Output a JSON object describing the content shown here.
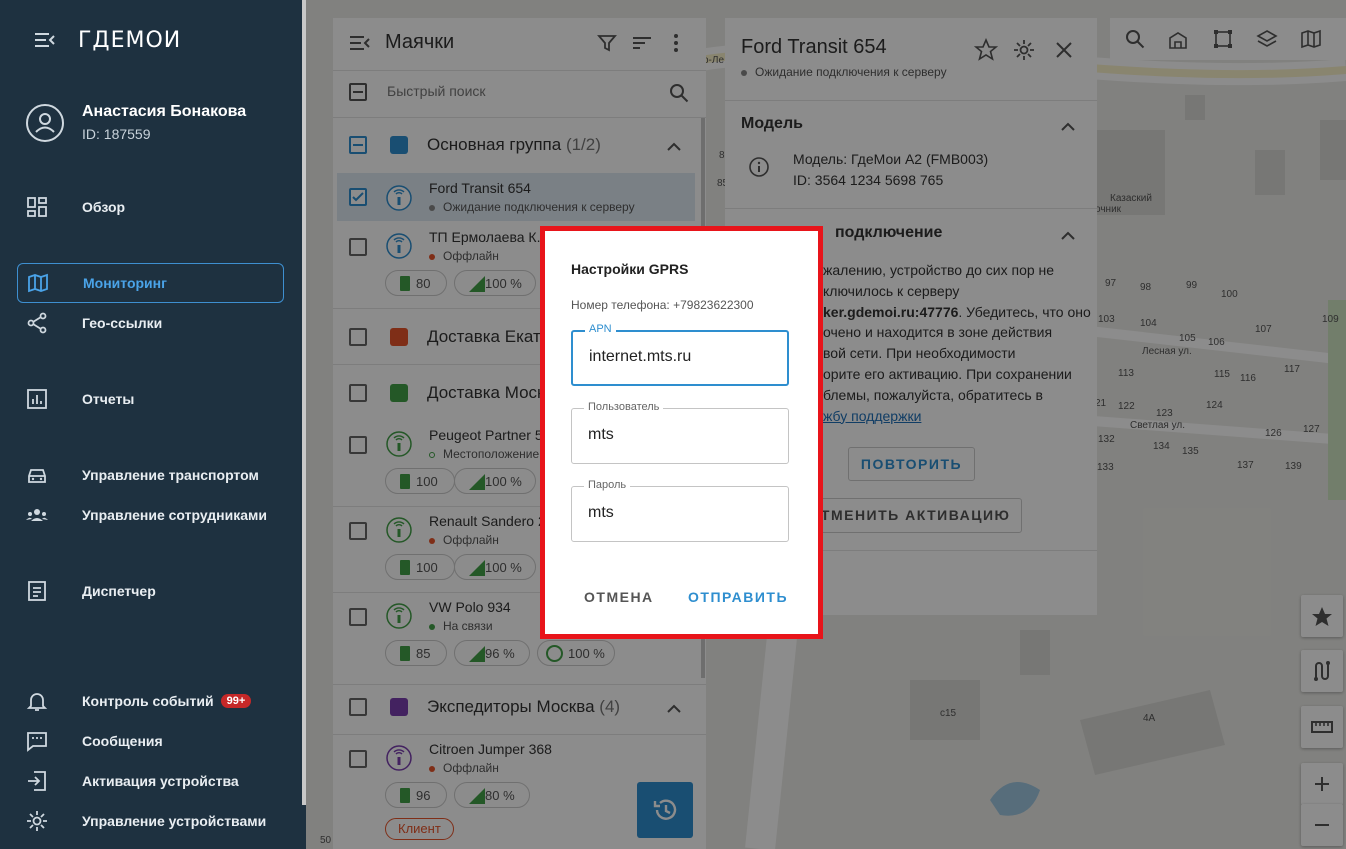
{
  "brand": {
    "logo": "ГДЕМОИ"
  },
  "user": {
    "name": "Анастасия Бонакова",
    "id": "ID: 187559"
  },
  "nav": [
    {
      "label": "Обзор"
    },
    {
      "label": "Мониторинг"
    },
    {
      "label": "Гео-ссылки"
    },
    {
      "label": "Отчеты"
    },
    {
      "label": "Управление транспортом"
    },
    {
      "label": "Управление сотрудниками"
    },
    {
      "label": "Диспетчер"
    },
    {
      "label": "Контроль событий",
      "badge": "99+"
    },
    {
      "label": "Сообщения"
    },
    {
      "label": "Активация устройства"
    },
    {
      "label": "Управление устройствами"
    }
  ],
  "list": {
    "title": "Маячки",
    "search_placeholder": "Быстрый поиск",
    "groups": [
      {
        "name": "Основная группа",
        "count": "(1/2)",
        "color": "#2e8ecf"
      },
      {
        "name": "Доставка Екат",
        "color": "#e8542a"
      },
      {
        "name": "Доставка Моск",
        "color": "#43a047"
      },
      {
        "name": "Экспедиторы Москва",
        "count": "(4)",
        "color": "#7b3fb0"
      }
    ],
    "items": [
      {
        "title": "Ford Transit 654",
        "status": "Ожидание подключения к серверу",
        "status_color": "#888"
      },
      {
        "title": "ТП Ермолаева К.",
        "status": "Оффлайн",
        "status_color": "#e8542a",
        "battery": "80",
        "signal": "100 %"
      },
      {
        "title": "Peugeot Partner 5",
        "status": "Местоположение",
        "status_color": "#43a047",
        "battery": "100",
        "signal": "100 %"
      },
      {
        "title": "Renault Sandero 2",
        "status": "Оффлайн",
        "status_color": "#e8542a",
        "battery": "100",
        "signal": "100 %"
      },
      {
        "title": "VW Polo 934",
        "status": "На связи",
        "status_color": "#43a047",
        "battery": "85",
        "signal": "96 %",
        "gps": "100 %"
      },
      {
        "title": "Citroen Jumper 368",
        "status": "Оффлайн",
        "status_color": "#e8542a",
        "battery": "96",
        "signal": "80 %",
        "tag": "Клиент"
      }
    ],
    "scale": "50"
  },
  "detail": {
    "title": "Ford Transit 654",
    "status": "Ожидание подключения к серверу",
    "model_section": "Модель",
    "model_line1": "Модель: ГдеМои А2 (FMB003)",
    "model_line2": "ID: 3564 1234 5698 765",
    "conn_section": "подключение",
    "conn_text1": "жалению, устройство до сих пор не",
    "conn_text2": "ключилось к серверу",
    "conn_text3": "ker.gdemoi.ru:47776",
    "conn_text3b": ". Убедитесь, что оно",
    "conn_text4": "очено и находится в зоне действия",
    "conn_text5": "вой сети. При необходимости",
    "conn_text6": "орите его активацию. При сохранении",
    "conn_text7": "блемы, пожалуйста, обратитесь в",
    "conn_link": "жбу поддержки",
    "retry": "ПОВТОРИТЬ",
    "cancel_activation": "ОТМЕНИТЬ АКТИВАЦИЮ"
  },
  "dialog": {
    "title": "Настройки GPRS",
    "phone": "Номер телефона: +79823622300",
    "apn_label": "APN",
    "apn_value": "internet.mts.ru",
    "user_label": "Пользователь",
    "user_value": "mts",
    "pass_label": "Пароль",
    "pass_value": "mts",
    "cancel": "ОТМЕНА",
    "submit": "ОТПРАВИТЬ"
  },
  "map": {
    "labels": [
      "о-Ле",
      "85",
      "8",
      "Казаский",
      "очник",
      "97",
      "98",
      "99",
      "100",
      "103",
      "104",
      "105",
      "106",
      "107",
      "109",
      "Лесная ул.",
      "113",
      "115",
      "116",
      "117",
      "21",
      "122",
      "123",
      "124",
      "Светлая ул.",
      "126",
      "127",
      "132",
      "134",
      "135",
      "133",
      "137",
      "139",
      "с15",
      "4А"
    ]
  }
}
